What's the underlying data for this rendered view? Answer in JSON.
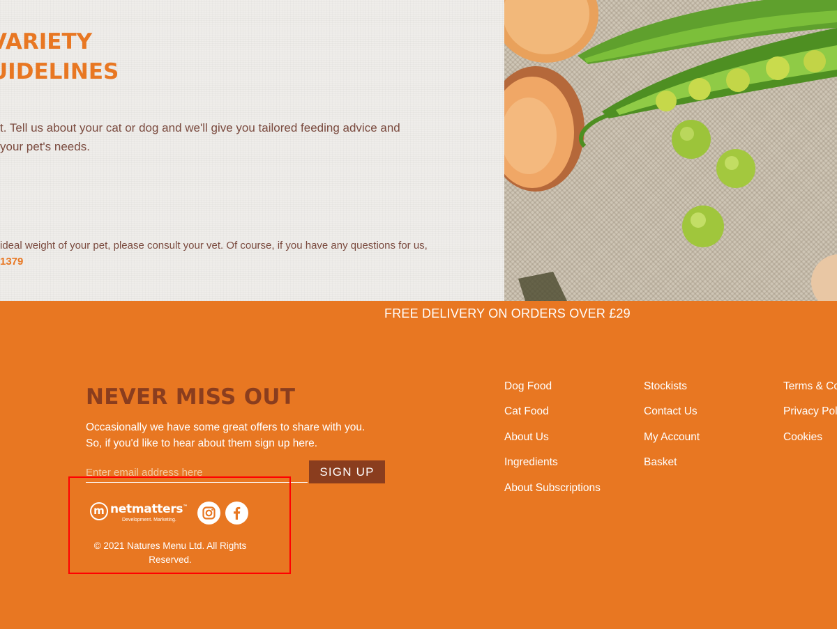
{
  "hero": {
    "heading_line1": "VARIETY",
    "heading_line2": "UIDELINES",
    "body_line1": "t. Tell us about your cat or dog and we'll give you tailored feeding advice and",
    "body_line2": "your pet's needs.",
    "note_line1": "ideal weight of your pet, please consult your vet. Of course, if you have any questions for us,",
    "phone_fragment": "1379"
  },
  "footer": {
    "delivery_banner": "FREE DELIVERY ON ORDERS OVER £29",
    "newsletter": {
      "title": "NEVER MISS OUT",
      "copy_line1": "Occasionally we have some great offers to share with you.",
      "copy_line2": "So, if you'd like to hear about them sign up here.",
      "email_placeholder": "Enter email address here",
      "email_value": "",
      "signup_label": "SIGN UP"
    },
    "netmatters": {
      "mark": "m",
      "word": "netmatters",
      "trademark": "™",
      "tagline": "Development. Marketing."
    },
    "social": {
      "instagram_icon": "instagram-icon",
      "facebook_icon": "facebook-icon"
    },
    "copyright_line1": "© 2021 Natures Menu Ltd. All Rights",
    "copyright_line2": "Reserved.",
    "links_col1": [
      "Dog Food",
      "Cat Food",
      "About Us",
      "Ingredients",
      "About Subscriptions"
    ],
    "links_col2": [
      "Stockists",
      "Contact Us",
      "My Account",
      "Basket"
    ],
    "links_col3": [
      "Terms & Co",
      "Privacy Poli",
      "Cookies"
    ]
  },
  "colors": {
    "brand_orange": "#e87722",
    "brand_brown": "#8a3d1e",
    "highlight_red": "#ff0000"
  }
}
